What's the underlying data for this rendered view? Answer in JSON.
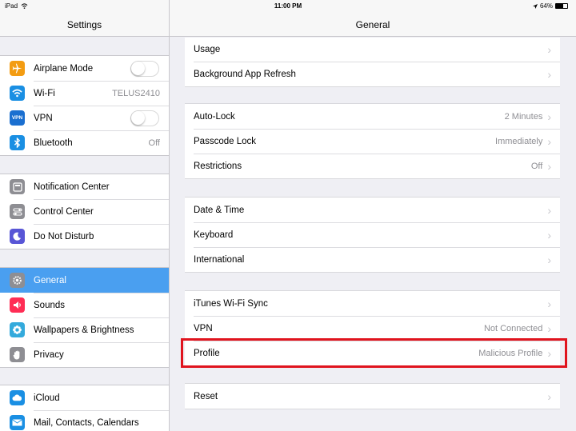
{
  "status_bar": {
    "device": "iPad",
    "wifi_icon": "wifi-icon",
    "time": "11:00 PM",
    "location_icon": "location-arrow-icon",
    "battery_text": "64%",
    "battery_level": 0.64
  },
  "sidebar": {
    "title": "Settings",
    "groups": [
      {
        "items": [
          {
            "label": "Airplane Mode",
            "icon": "airplane-icon",
            "color": "#f39c12",
            "control": "toggle-off"
          },
          {
            "label": "Wi-Fi",
            "icon": "wifi-icon",
            "color": "#1a8fe3",
            "value": "TELUS2410"
          },
          {
            "label": "VPN",
            "icon": "vpn-icon",
            "color": "#1a6fd0",
            "control": "toggle-off"
          },
          {
            "label": "Bluetooth",
            "icon": "bluetooth-icon",
            "color": "#1a8fe3",
            "value": "Off"
          }
        ]
      },
      {
        "items": [
          {
            "label": "Notification Center",
            "icon": "notification-center-icon",
            "color": "#8e8e93"
          },
          {
            "label": "Control Center",
            "icon": "control-center-icon",
            "color": "#8e8e93"
          },
          {
            "label": "Do Not Disturb",
            "icon": "moon-icon",
            "color": "#5856d6"
          }
        ]
      },
      {
        "items": [
          {
            "label": "General",
            "icon": "gear-icon",
            "color": "#8e8e93",
            "selected": true
          },
          {
            "label": "Sounds",
            "icon": "speaker-icon",
            "color": "#ff2d55"
          },
          {
            "label": "Wallpapers & Brightness",
            "icon": "flower-icon",
            "color": "#34aadc"
          },
          {
            "label": "Privacy",
            "icon": "hand-icon",
            "color": "#8e8e93"
          }
        ]
      },
      {
        "items": [
          {
            "label": "iCloud",
            "icon": "cloud-icon",
            "color": "#1a8fe3"
          },
          {
            "label": "Mail, Contacts, Calendars",
            "icon": "mail-icon",
            "color": "#1a8fe3"
          }
        ]
      }
    ]
  },
  "main": {
    "title": "General",
    "groups": [
      {
        "items": [
          {
            "label": "Usage"
          },
          {
            "label": "Background App Refresh"
          }
        ]
      },
      {
        "items": [
          {
            "label": "Auto-Lock",
            "value": "2 Minutes"
          },
          {
            "label": "Passcode Lock",
            "value": "Immediately"
          },
          {
            "label": "Restrictions",
            "value": "Off"
          }
        ]
      },
      {
        "items": [
          {
            "label": "Date & Time"
          },
          {
            "label": "Keyboard"
          },
          {
            "label": "International"
          }
        ]
      },
      {
        "items": [
          {
            "label": "iTunes Wi-Fi Sync"
          },
          {
            "label": "VPN",
            "value": "Not Connected"
          },
          {
            "label": "Profile",
            "value": "Malicious Profile",
            "highlighted": true
          }
        ]
      },
      {
        "items": [
          {
            "label": "Reset"
          }
        ]
      }
    ]
  },
  "colors": {
    "selection": "#4a9ff0",
    "highlight_border": "#e0141e",
    "background": "#efeff4"
  }
}
